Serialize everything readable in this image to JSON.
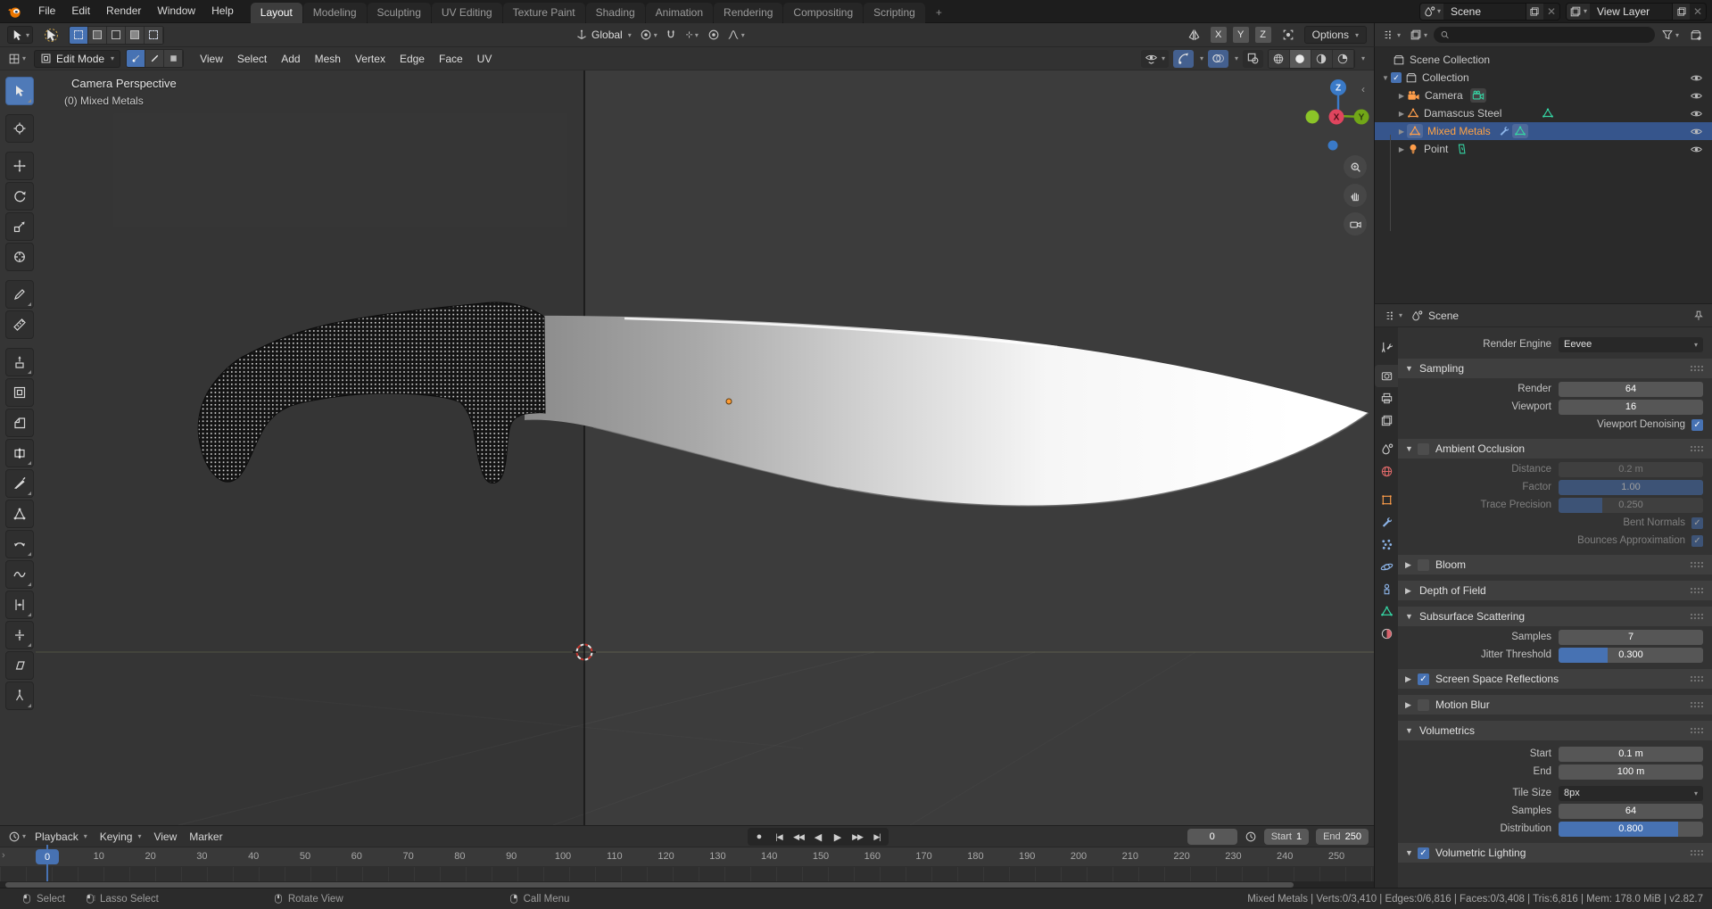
{
  "topbar": {
    "menus": [
      "File",
      "Edit",
      "Render",
      "Window",
      "Help"
    ],
    "tabs": [
      "Layout",
      "Modeling",
      "Sculpting",
      "UV Editing",
      "Texture Paint",
      "Shading",
      "Animation",
      "Rendering",
      "Compositing",
      "Scripting"
    ],
    "active_tab": "Layout",
    "new_tab_label": "+",
    "scene_selector": {
      "label": "Scene"
    },
    "view_layer_selector": {
      "label": "View Layer"
    }
  },
  "tool_settings": {
    "orientation": "Global",
    "mirror_axes": [
      "X",
      "Y",
      "Z"
    ],
    "options_label": "Options"
  },
  "viewport_header": {
    "mode": "Edit Mode",
    "menus": [
      "View",
      "Select",
      "Add",
      "Mesh",
      "Vertex",
      "Edge",
      "Face",
      "UV"
    ]
  },
  "viewport": {
    "overlay_line1": "Camera Perspective",
    "overlay_line2": "(0) Mixed Metals",
    "gizmo_axis_x": "X",
    "gizmo_axis_y": "Y",
    "gizmo_axis_z": "Z",
    "side_icons": [
      "zoom-icon",
      "pan-hand-icon",
      "camera-view-icon"
    ]
  },
  "toolbar_tools": [
    "select-box",
    "cursor",
    "move",
    "rotate",
    "scale",
    "transform",
    "annotate",
    "measure",
    "extrude-region",
    "inset-faces",
    "bevel",
    "loop-cut",
    "knife",
    "poly-build",
    "spin",
    "smooth",
    "edge-slide",
    "shrink-fatten",
    "shear",
    "rip-region"
  ],
  "outliner": {
    "rows": [
      {
        "label": "Scene Collection",
        "icon": "collection"
      },
      {
        "label": "Collection",
        "icon": "collection",
        "checked": true
      },
      {
        "label": "Camera",
        "icon": "camera",
        "data_icon": "camera-data"
      },
      {
        "label": "Damascus Steel",
        "icon": "mesh",
        "data_icon": "mesh-data"
      },
      {
        "label": "Mixed Metals",
        "icon": "mesh",
        "data_icon": "mesh-data",
        "modifier_icon": "wrench",
        "selected": true
      },
      {
        "label": "Point",
        "icon": "light",
        "data_icon": "light-data"
      }
    ]
  },
  "properties": {
    "breadcrumb": "Scene",
    "render_engine_label": "Render Engine",
    "render_engine_value": "Eevee",
    "sampling": {
      "title": "Sampling",
      "render_label": "Render",
      "render_value": "64",
      "viewport_label": "Viewport",
      "viewport_value": "16",
      "denoising_label": "Viewport Denoising",
      "denoising_checked": true
    },
    "ambient_occlusion": {
      "title": "Ambient Occlusion",
      "enabled": false,
      "distance_label": "Distance",
      "distance_value": "0.2 m",
      "factor_label": "Factor",
      "factor_value": "1.00",
      "trace_label": "Trace Precision",
      "trace_value": "0.250",
      "bent_label": "Bent Normals",
      "bent_checked": true,
      "bounces_label": "Bounces Approximation",
      "bounces_checked": true
    },
    "bloom": {
      "title": "Bloom",
      "enabled": false
    },
    "dof": {
      "title": "Depth of Field"
    },
    "sss": {
      "title": "Subsurface Scattering",
      "samples_label": "Samples",
      "samples_value": "7",
      "jitter_label": "Jitter Threshold",
      "jitter_value": "0.300"
    },
    "ssr": {
      "title": "Screen Space Reflections",
      "enabled": true
    },
    "motion_blur": {
      "title": "Motion Blur",
      "enabled": false
    },
    "volumetrics": {
      "title": "Volumetrics",
      "start_label": "Start",
      "start_value": "0.1 m",
      "end_label": "End",
      "end_value": "100 m",
      "tile_label": "Tile Size",
      "tile_value": "8px",
      "samples_label": "Samples",
      "samples_value": "64",
      "dist_label": "Distribution",
      "dist_value": "0.800"
    },
    "vol_lighting": {
      "title": "Volumetric Lighting",
      "enabled": true
    }
  },
  "timeline": {
    "menus": [
      "Playback",
      "Keying",
      "View",
      "Marker"
    ],
    "transport": [
      "record",
      "jump-start",
      "prev-keyframe",
      "play-reverse",
      "play",
      "next-keyframe",
      "jump-end"
    ],
    "current_frame": "0",
    "frame_field_value": "0",
    "start_label": "Start",
    "start_value": "1",
    "end_label": "End",
    "end_value": "250",
    "ruler_ticks": [
      0,
      10,
      20,
      30,
      40,
      50,
      60,
      70,
      80,
      90,
      100,
      110,
      120,
      130,
      140,
      150,
      160,
      170,
      180,
      190,
      200,
      210,
      220,
      230,
      240,
      250
    ]
  },
  "status_bar": {
    "hints": [
      {
        "icon": "mouse-left",
        "label": "Select"
      },
      {
        "icon": "mouse-left-drag",
        "label": "Lasso Select"
      },
      {
        "icon": "mouse-middle",
        "label": "Rotate View"
      },
      {
        "icon": "mouse-right",
        "label": "Call Menu"
      }
    ],
    "stats": "Mixed Metals | Verts:0/3,410 | Edges:0/6,816 | Faces:0/3,408 | Tris:6,816 | Mem: 178.0 MiB | v2.82.7"
  },
  "colors": {
    "accent_blue": "#4772b3",
    "selection_row": "#36558c",
    "active_object_text": "#ffa344",
    "object_orange": "#ff9e4a",
    "data_green": "#35d6a4",
    "modifier_blue": "#8cb4e8",
    "axis_x": "#e0455e",
    "axis_y": "#71a617",
    "axis_z": "#3a7ac8"
  }
}
